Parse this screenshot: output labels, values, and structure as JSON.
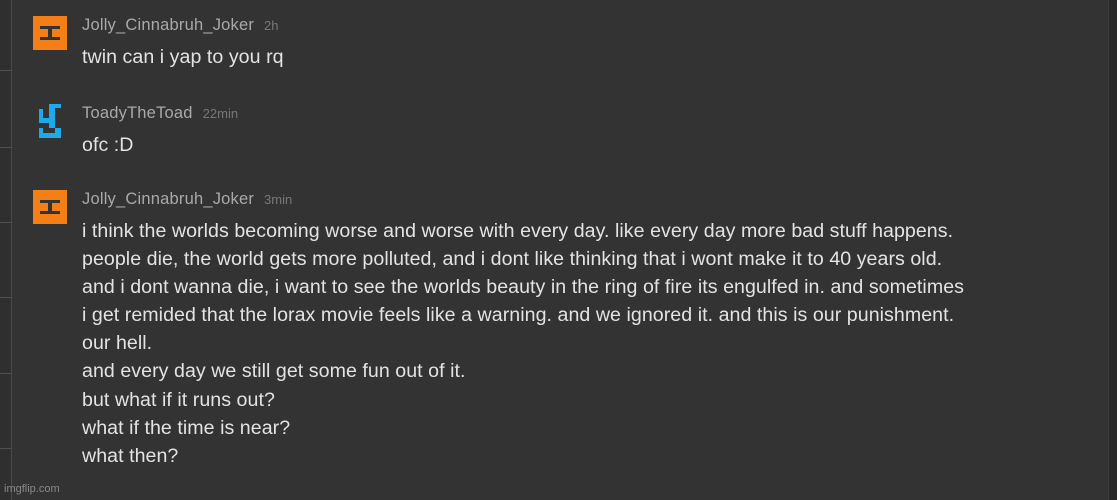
{
  "messages": [
    {
      "username": "Jolly_Cinnabruh_Joker",
      "timestamp": "2h",
      "avatar": "orange-pixel-avatar",
      "avatar_color": "#f57f17",
      "lines": [
        "twin can i yap to you rq"
      ]
    },
    {
      "username": "ToadyTheToad",
      "timestamp": "22min",
      "avatar": "blue-pixel-avatar",
      "avatar_color": "#1ea9ec",
      "lines": [
        "ofc :D"
      ]
    },
    {
      "username": "Jolly_Cinnabruh_Joker",
      "timestamp": "3min",
      "avatar": "orange-pixel-avatar",
      "avatar_color": "#f57f17",
      "lines": [
        "i think the worlds becoming worse and worse with every day. like every day more bad stuff happens.",
        "people die, the world gets more polluted, and i dont like thinking that i wont make it to 40 years old.",
        "and i dont wanna die, i want to see the worlds beauty in the ring of fire its engulfed in. and sometimes",
        "i get remided that the lorax movie feels like a warning. and we ignored it. and this is our punishment.",
        "our hell.",
        "and every day we still get some fun out of it.",
        "but what if it runs out?",
        "what if the time is near?",
        "what then?"
      ]
    }
  ],
  "watermark": "imgflip.com"
}
